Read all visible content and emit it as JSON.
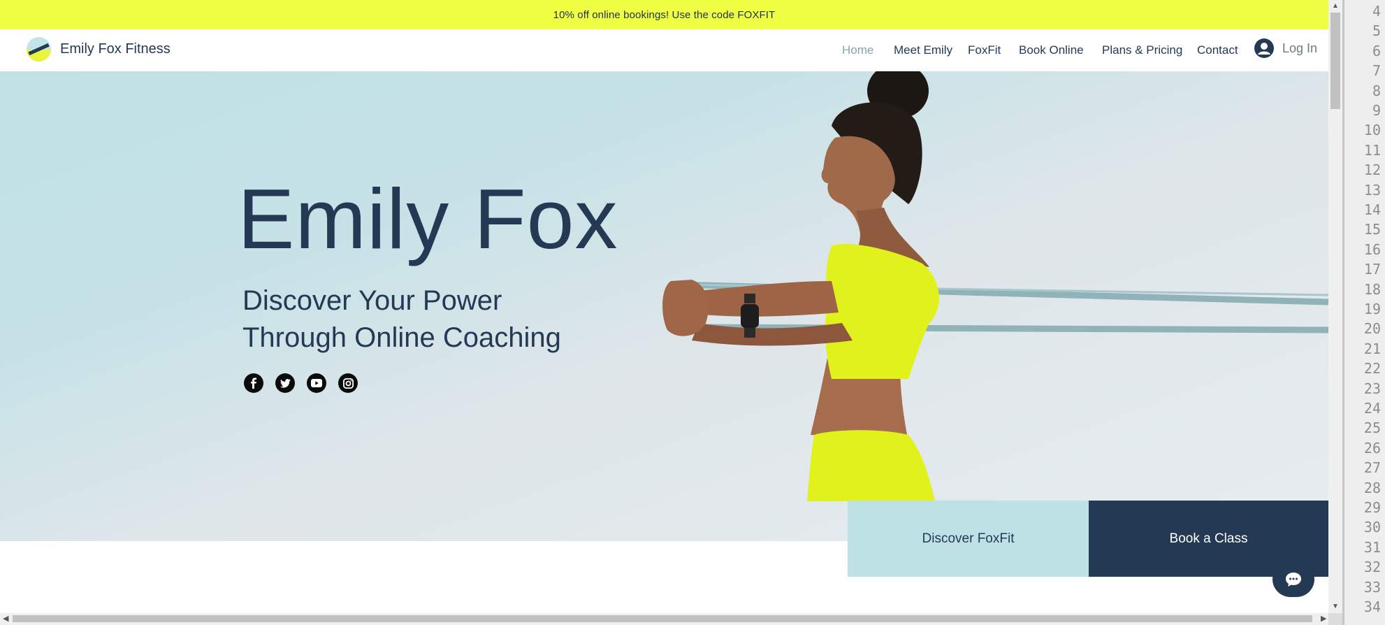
{
  "promo_banner": {
    "text": "10% off online bookings! Use the code FOXFIT"
  },
  "header": {
    "brand_name": "Emily Fox Fitness",
    "nav": [
      {
        "label": "Home",
        "active": true
      },
      {
        "label": "Meet Emily",
        "active": false
      },
      {
        "label": "FoxFit",
        "active": false
      },
      {
        "label": "Book Online",
        "active": false
      },
      {
        "label": "Plans & Pricing",
        "active": false
      },
      {
        "label": "Contact",
        "active": false
      }
    ],
    "login_label": "Log In"
  },
  "hero": {
    "title": "Emily Fox",
    "subtitle_line1": "Discover Your Power",
    "subtitle_line2": "Through Online Coaching",
    "social_icons": [
      "facebook-icon",
      "twitter-icon",
      "youtube-icon",
      "instagram-icon"
    ]
  },
  "cta": {
    "primary_label": "Discover FoxFit",
    "secondary_label": "Book a Class"
  },
  "gutter_line_numbers": [
    "4",
    "5",
    "6",
    "7",
    "8",
    "9",
    "10",
    "11",
    "12",
    "13",
    "14",
    "15",
    "16",
    "17",
    "18",
    "19",
    "20",
    "21",
    "22",
    "23",
    "24",
    "25",
    "26",
    "27",
    "28",
    "29",
    "30",
    "31",
    "32",
    "33",
    "34"
  ],
  "colors": {
    "banner": "#eeff44",
    "navy": "#243a54",
    "hero_light_blue": "#bee1e6",
    "accent_yellow": "#e3f21f"
  }
}
